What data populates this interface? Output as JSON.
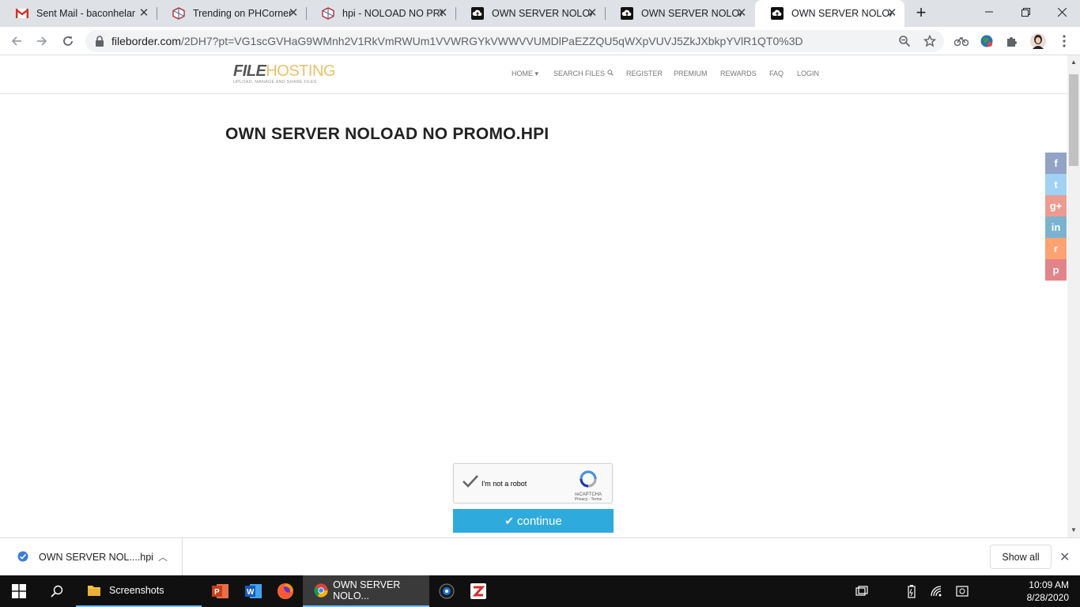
{
  "tabs": [
    {
      "title": "Sent Mail - baconhelar",
      "icon": "gmail-icon"
    },
    {
      "title": "Trending on PHCorner |",
      "icon": "phcorner-icon"
    },
    {
      "title": "hpi - NOLOAD NO PRO",
      "icon": "phcorner-icon"
    },
    {
      "title": "OWN SERVER NOLOAD",
      "icon": "cloud-upload-icon"
    },
    {
      "title": "OWN SERVER NOLOAD",
      "icon": "cloud-upload-icon"
    },
    {
      "title": "OWN SERVER NOLOAD",
      "icon": "cloud-upload-icon",
      "active": true
    }
  ],
  "address": {
    "host": "fileborder.com",
    "path": "/2DH7?pt=VG1scGVHaG9WMnh2V1RkVmRWUm1VVWRGYkVWWVVUMDlPaEZZQU5qWXpVUVJ5ZkJXbkpYVlR1QT0%3D"
  },
  "site": {
    "logo_a": "FILE",
    "logo_b": "HOSTING",
    "tagline": "UPLOAD, MANAGE AND SHARE FILES",
    "menu": {
      "home": "HOME ▾",
      "search": "SEARCH FILES",
      "register": "REGISTER",
      "premium": "PREMIUM",
      "rewards": "REWARDS",
      "faq": "FAQ",
      "login": "LOGIN"
    }
  },
  "file_title": "OWN SERVER NOLOAD NO PROMO.HPI",
  "recaptcha": {
    "label": "I'm not a robot",
    "brand": "reCAPTCHA",
    "links": "Privacy - Terms"
  },
  "continue_label": "continue",
  "share": [
    {
      "name": "facebook",
      "glyph": "f",
      "color": "#3b5998"
    },
    {
      "name": "twitter",
      "glyph": "t",
      "color": "#55acee"
    },
    {
      "name": "google-plus",
      "glyph": "g+",
      "color": "#dd4b39"
    },
    {
      "name": "linkedin",
      "glyph": "in",
      "color": "#0e76a8"
    },
    {
      "name": "reddit",
      "glyph": "r",
      "color": "#ff5700"
    },
    {
      "name": "pinterest",
      "glyph": "p",
      "color": "#cb2027"
    }
  ],
  "download": {
    "file": "OWN SERVER NOL....hpi",
    "show_all": "Show all"
  },
  "taskbar": {
    "explorer_label": "Screenshots",
    "chrome_label": "OWN SERVER NOLO...",
    "time": "10:09 AM",
    "date": "8/28/2020"
  }
}
